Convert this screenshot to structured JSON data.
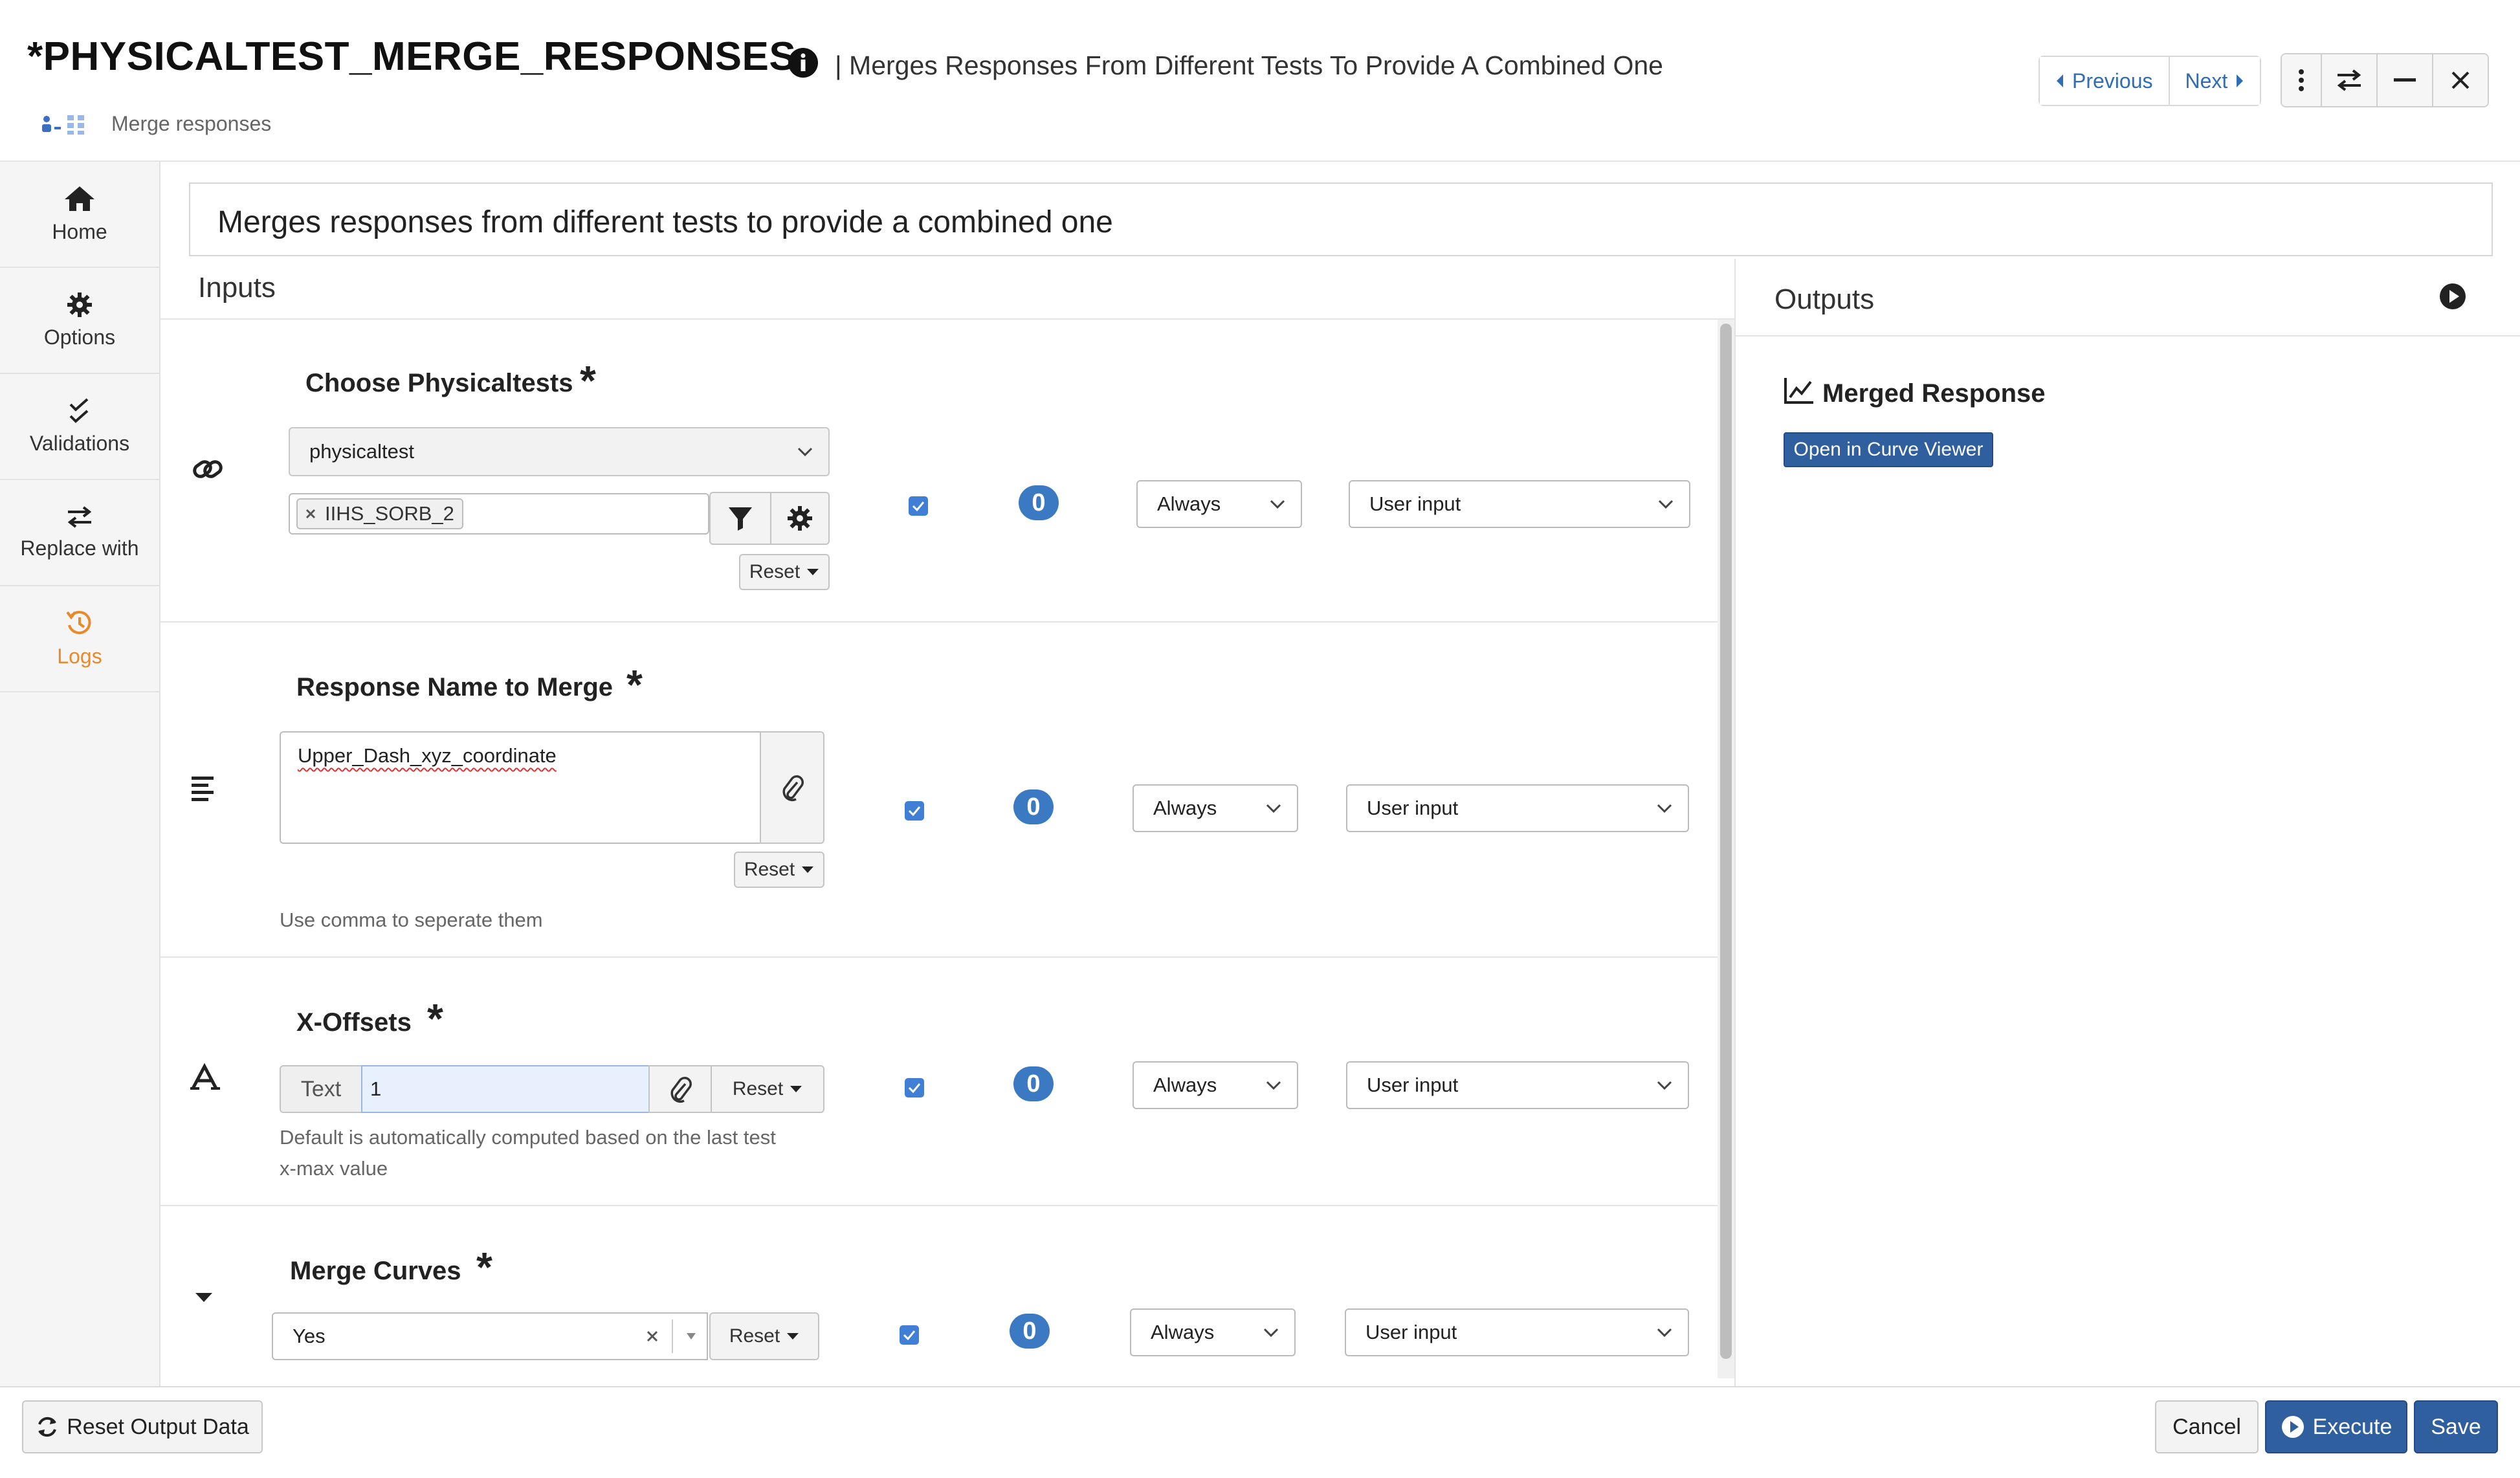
{
  "header": {
    "title": "*PHYSICALTEST_MERGE_RESPONSES",
    "subtitle": "| Merges Responses From Different Tests To Provide A Combined One",
    "breadcrumb": "Merge responses",
    "nav": {
      "previous": "Previous",
      "next": "Next"
    }
  },
  "sidebar": {
    "items": [
      {
        "label": "Home",
        "icon": "home-icon"
      },
      {
        "label": "Options",
        "icon": "gear-icon"
      },
      {
        "label": "Validations",
        "icon": "checks-icon"
      },
      {
        "label": "Replace with",
        "icon": "swap-icon"
      },
      {
        "label": "Logs",
        "icon": "history-icon"
      }
    ]
  },
  "description": "Merges responses from different tests to provide a combined one",
  "inputs": {
    "heading": "Inputs",
    "rows": [
      {
        "label": "Choose Physicaltests",
        "required": "*",
        "type_select": "physicaltest",
        "tag": "IIHS_SORB_2",
        "reset": "Reset",
        "checked": true,
        "count": "0",
        "mode": "Always",
        "source": "User input"
      },
      {
        "label": "Response Name to Merge",
        "required": "*",
        "value": "Upper_Dash_xyz_coordinate",
        "reset": "Reset",
        "help": "Use comma to seperate them",
        "checked": true,
        "count": "0",
        "mode": "Always",
        "source": "User input"
      },
      {
        "label": "X-Offsets",
        "required": "*",
        "addon": "Text",
        "value": "1",
        "reset": "Reset",
        "help_line1": "Default is automatically computed based on the last test",
        "help_line2": "x-max value",
        "checked": true,
        "count": "0",
        "mode": "Always",
        "source": "User input"
      },
      {
        "label": "Merge Curves",
        "required": "*",
        "value": "Yes",
        "reset": "Reset",
        "checked": true,
        "count": "0",
        "mode": "Always",
        "source": "User input"
      }
    ]
  },
  "outputs": {
    "heading": "Outputs",
    "items": [
      {
        "name": "Merged Response",
        "button": "Open in Curve Viewer"
      }
    ]
  },
  "footer": {
    "reset_output": "Reset Output Data",
    "cancel": "Cancel",
    "execute": "Execute",
    "save": "Save"
  },
  "colors": {
    "accent": "#2f5f9e",
    "link": "#2f6db5",
    "badge": "#3c79c3",
    "logs": "#e88a2a"
  }
}
